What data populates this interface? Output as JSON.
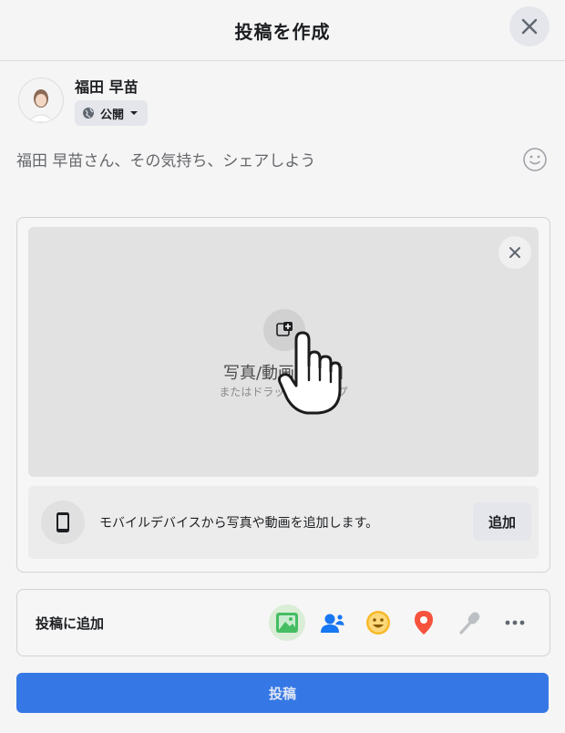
{
  "dialog": {
    "title": "投稿を作成",
    "close_icon": "close-icon"
  },
  "user": {
    "name": "福田 早苗",
    "privacy_label": "公開"
  },
  "composer": {
    "placeholder": "福田 早苗さん、その気持ち、シェアしよう"
  },
  "media": {
    "title": "写真/動画を追加",
    "subtitle": "またはドラッグ&ドロップ",
    "mobile_text": "モバイルデバイスから写真や動画を追加します。",
    "add_label": "追加"
  },
  "add_to_post": {
    "label": "投稿に追加",
    "icons": [
      "photo-icon",
      "tag-people-icon",
      "feeling-icon",
      "location-icon",
      "mic-icon",
      "more-icon"
    ]
  },
  "post_button": {
    "label": "投稿"
  },
  "colors": {
    "primary": "#3578e5",
    "photo_green": "#45bd62",
    "tag_blue": "#1877f2",
    "feeling_yellow": "#f7b928",
    "location_red": "#f5533d"
  }
}
